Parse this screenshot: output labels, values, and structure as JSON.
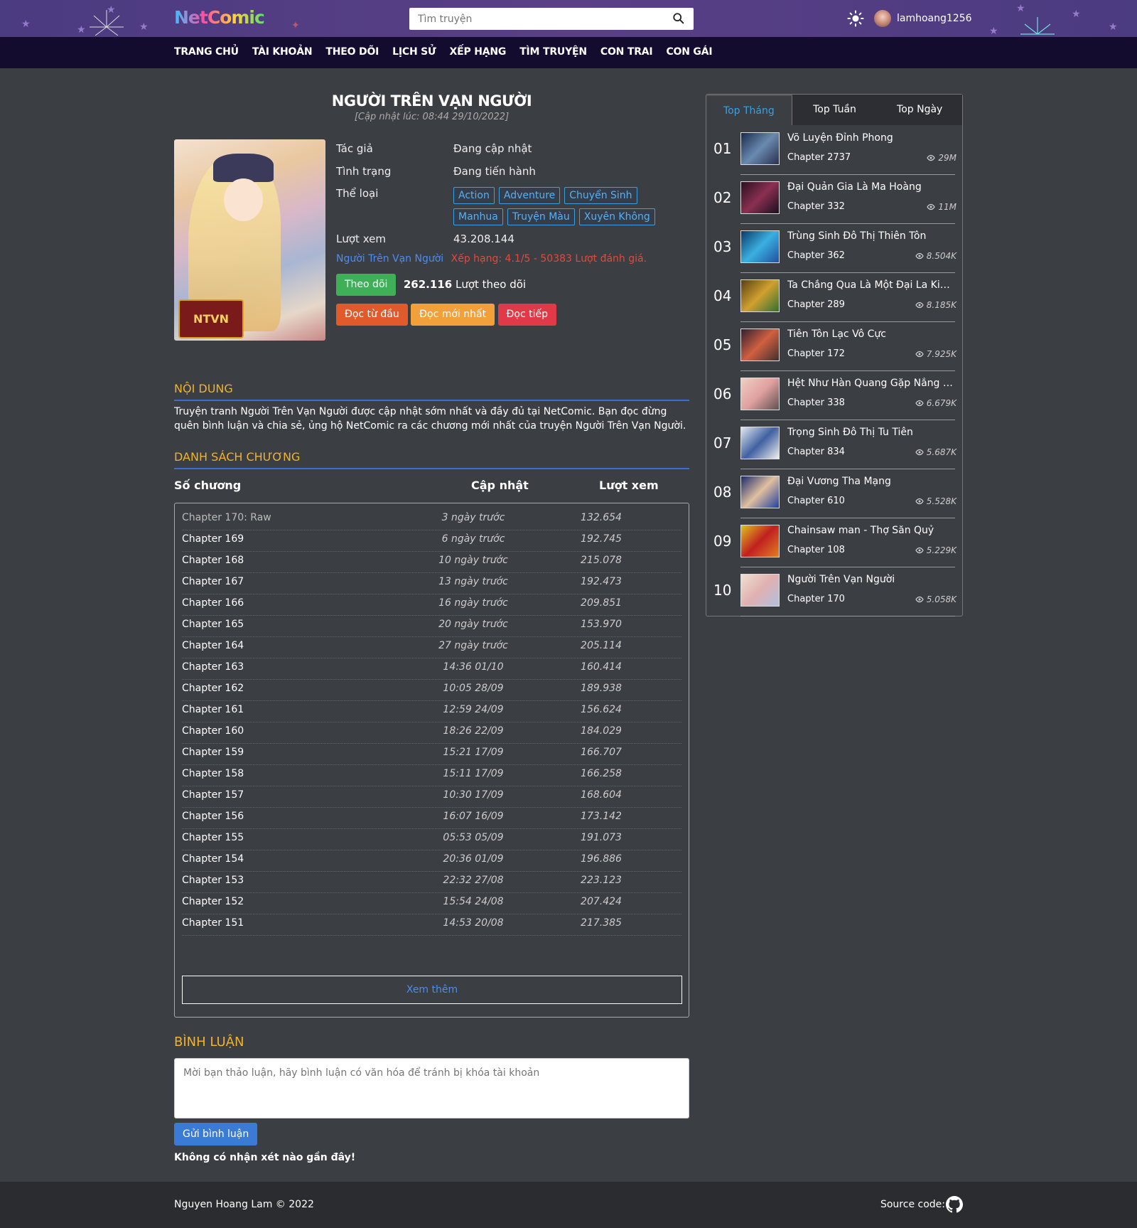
{
  "header": {
    "logo": "NetComic",
    "search_placeholder": "Tìm truyện",
    "username": "lamhoang1256"
  },
  "nav": [
    "TRANG CHỦ",
    "TÀI KHOẢN",
    "THEO DÕI",
    "LỊCH SỬ",
    "XẾP HẠNG",
    "TÌM TRUYỆN",
    "CON TRAI",
    "CON GÁI"
  ],
  "comic": {
    "title": "NGƯỜI TRÊN VẠN NGƯỜI",
    "updated": "[Cập nhật lúc: 08:44 29/10/2022]",
    "cover_label": "NTVN",
    "author_label": "Tác giả",
    "author": "Đang cập nhật",
    "status_label": "Tình trạng",
    "status": "Đang tiến hành",
    "genre_label": "Thể loại",
    "genres": [
      "Action",
      "Adventure",
      "Chuyển Sinh",
      "Manhua",
      "Truyện Màu",
      "Xuyên Không"
    ],
    "views_label": "Lượt xem",
    "views": "43.208.144",
    "name_link": "Người Trên Vạn Người",
    "rating": "Xếp hạng: 4.1/5 - 50383 Lượt đánh giá.",
    "follow_button": "Theo dõi",
    "follow_count": "262.116",
    "follow_suffix": "Lượt theo dõi",
    "read_first": "Đọc từ đầu",
    "read_latest": "Đọc mới nhất",
    "read_continue": "Đọc tiếp"
  },
  "content": {
    "heading": "NỘI DUNG",
    "text": "Truyện tranh Người Trên Vạn Người được cập nhật sớm nhất và đầy đủ tại NetComic. Bạn đọc đừng quên bình luận và chia sẻ, ủng hộ NetComic ra các chương mới nhất của truyện Người Trên Vạn Người."
  },
  "chapters": {
    "heading": "DANH SÁCH CHƯƠNG",
    "col_chapter": "Số chương",
    "col_updated": "Cập nhật",
    "col_views": "Lượt xem",
    "rows": [
      {
        "name": "Chapter 170: Raw",
        "updated": "3 ngày trước",
        "views": "132.654"
      },
      {
        "name": "Chapter 169",
        "updated": "6 ngày trước",
        "views": "192.745"
      },
      {
        "name": "Chapter 168",
        "updated": "10 ngày trước",
        "views": "215.078"
      },
      {
        "name": "Chapter 167",
        "updated": "13 ngày trước",
        "views": "192.473"
      },
      {
        "name": "Chapter 166",
        "updated": "16 ngày trước",
        "views": "209.851"
      },
      {
        "name": "Chapter 165",
        "updated": "20 ngày trước",
        "views": "153.970"
      },
      {
        "name": "Chapter 164",
        "updated": "27 ngày trước",
        "views": "205.114"
      },
      {
        "name": "Chapter 163",
        "updated": "14:36 01/10",
        "views": "160.414"
      },
      {
        "name": "Chapter 162",
        "updated": "10:05 28/09",
        "views": "189.938"
      },
      {
        "name": "Chapter 161",
        "updated": "12:59 24/09",
        "views": "156.624"
      },
      {
        "name": "Chapter 160",
        "updated": "18:26 22/09",
        "views": "184.029"
      },
      {
        "name": "Chapter 159",
        "updated": "15:21 17/09",
        "views": "166.707"
      },
      {
        "name": "Chapter 158",
        "updated": "15:11 17/09",
        "views": "166.258"
      },
      {
        "name": "Chapter 157",
        "updated": "10:30 17/09",
        "views": "168.604"
      },
      {
        "name": "Chapter 156",
        "updated": "16:07 16/09",
        "views": "173.142"
      },
      {
        "name": "Chapter 155",
        "updated": "05:53 05/09",
        "views": "191.073"
      },
      {
        "name": "Chapter 154",
        "updated": "20:36 01/09",
        "views": "196.886"
      },
      {
        "name": "Chapter 153",
        "updated": "22:32 27/08",
        "views": "223.123"
      },
      {
        "name": "Chapter 152",
        "updated": "15:54 24/08",
        "views": "207.424"
      },
      {
        "name": "Chapter 151",
        "updated": "14:53 20/08",
        "views": "217.385"
      }
    ],
    "more": "Xem thêm"
  },
  "comments": {
    "heading": "BÌNH LUẬN",
    "placeholder": "Mời bạn thảo luận, hãy bình luận có văn hóa để tránh bị khóa tài khoản",
    "send": "Gửi bình luận",
    "empty": "Không có nhận xét nào gần đây!"
  },
  "sidebar": {
    "tabs": [
      "Top Tháng",
      "Top Tuần",
      "Top Ngày"
    ],
    "items": [
      {
        "rank": "01",
        "name": "Võ Luyện Đỉnh Phong",
        "chapter": "Chapter 2737",
        "views": "29M"
      },
      {
        "rank": "02",
        "name": "Đại Quản Gia Là Ma Hoàng",
        "chapter": "Chapter 332",
        "views": "11M"
      },
      {
        "rank": "03",
        "name": "Trùng Sinh Đô Thị Thiên Tôn",
        "chapter": "Chapter 362",
        "views": "8.504K"
      },
      {
        "rank": "04",
        "name": "Ta Chẳng Qua Là Một Đại La Kim...",
        "chapter": "Chapter 289",
        "views": "8.185K"
      },
      {
        "rank": "05",
        "name": "Tiên Tôn Lạc Vô Cực",
        "chapter": "Chapter 172",
        "views": "7.925K"
      },
      {
        "rank": "06",
        "name": "Hệt Như Hàn Quang Gặp Nắng Gắt",
        "chapter": "Chapter 338",
        "views": "6.679K"
      },
      {
        "rank": "07",
        "name": "Trọng Sinh Đô Thị Tu Tiên",
        "chapter": "Chapter 834",
        "views": "5.687K"
      },
      {
        "rank": "08",
        "name": "Đại Vương Tha Mạng",
        "chapter": "Chapter 610",
        "views": "5.528K"
      },
      {
        "rank": "09",
        "name": "Chainsaw man - Thợ Săn Quỷ",
        "chapter": "Chapter 108",
        "views": "5.229K"
      },
      {
        "rank": "10",
        "name": "Người Trên Vạn Người",
        "chapter": "Chapter 170",
        "views": "5.058K"
      }
    ]
  },
  "footer": {
    "copyright": "Nguyen Hoang Lam © 2022",
    "source_label": "Source code:"
  },
  "colors": {
    "accent_yellow": "#f2b22a",
    "accent_blue": "#3a6fd0",
    "header_purple": "#4b3b80",
    "nav_dark": "#140c2f"
  }
}
